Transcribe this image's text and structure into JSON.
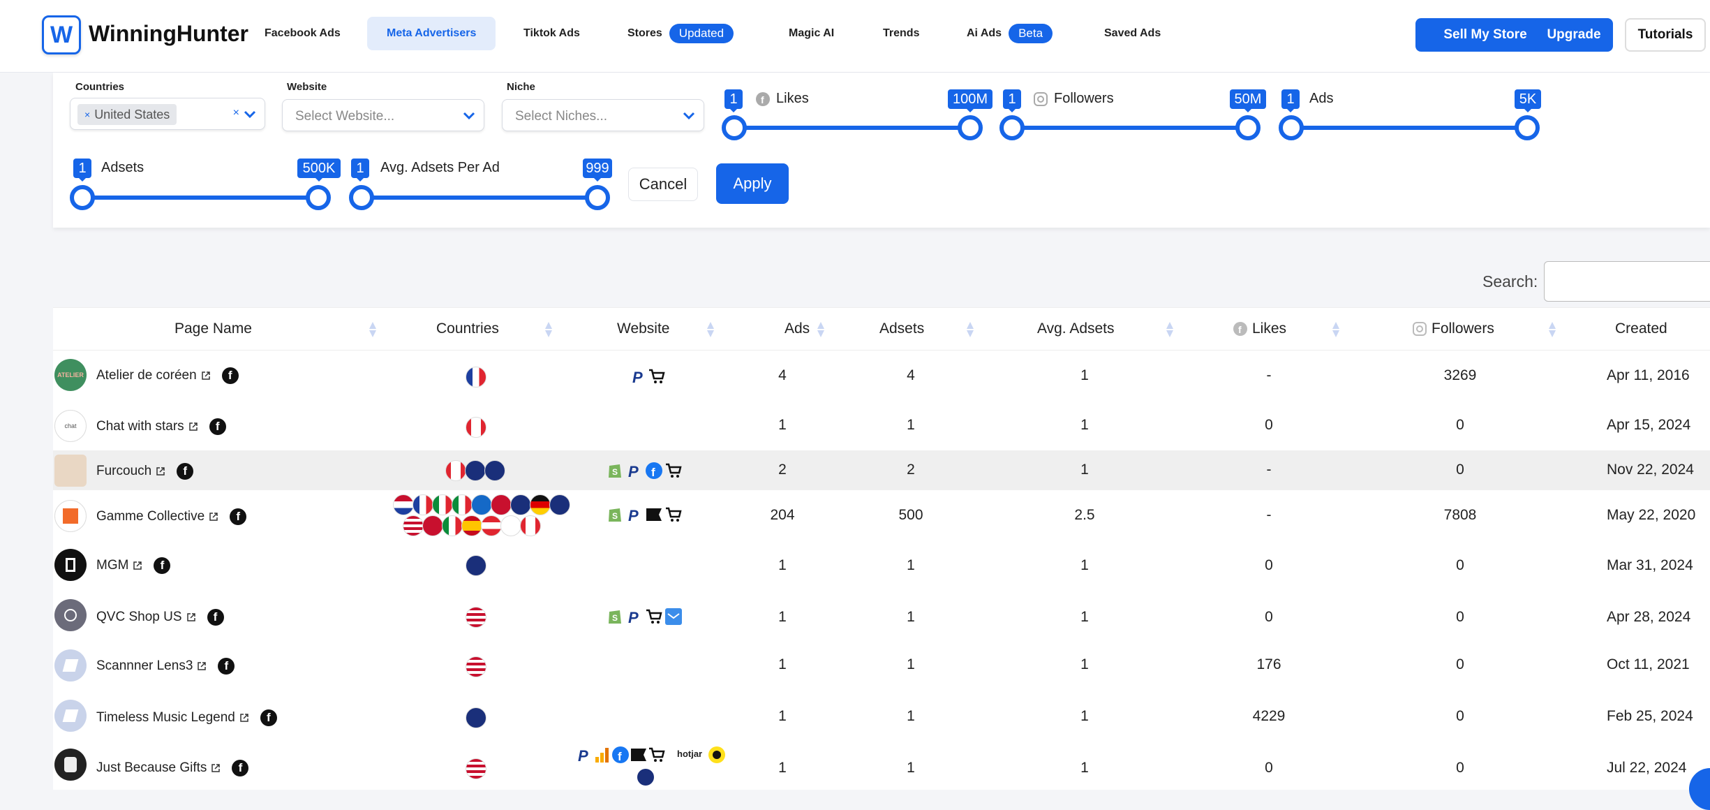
{
  "brand": {
    "name": "WinningHunter",
    "logo_letter": "W"
  },
  "nav": {
    "items": [
      {
        "label": "Facebook Ads"
      },
      {
        "label": "Meta Advertisers"
      },
      {
        "label": "Tiktok Ads"
      },
      {
        "label": "Stores",
        "badge": "Updated"
      },
      {
        "label": "Magic AI"
      },
      {
        "label": "Trends"
      },
      {
        "label": "Ai Ads",
        "badge": "Beta"
      },
      {
        "label": "Saved Ads"
      }
    ],
    "sell_button": "Sell My Store",
    "upgrade_button": "Upgrade",
    "tutorials_button": "Tutorials"
  },
  "filters": {
    "countries": {
      "label": "Countries",
      "selected": "United States"
    },
    "website": {
      "label": "Website",
      "placeholder": "Select Website..."
    },
    "niche": {
      "label": "Niche",
      "placeholder": "Select Niches..."
    },
    "likes": {
      "label": "Likes",
      "min": "1",
      "max": "100M"
    },
    "followers": {
      "label": "Followers",
      "min": "1",
      "max": "50M"
    },
    "ads": {
      "label": "Ads",
      "min": "1",
      "max": "5K"
    },
    "adsets": {
      "label": "Adsets",
      "min": "1",
      "max": "500K"
    },
    "avg_adsets": {
      "label": "Avg. Adsets Per Ad",
      "min": "1",
      "max": "999"
    },
    "cancel": "Cancel",
    "apply": "Apply"
  },
  "search": {
    "label": "Search:"
  },
  "table": {
    "columns": [
      "Page Name",
      "Countries",
      "Website",
      "Ads",
      "Adsets",
      "Avg. Adsets",
      "Likes",
      "Followers",
      "Created"
    ],
    "rows": [
      {
        "name": "Atelier de coréen",
        "ads": "4",
        "adsets": "4",
        "avg": "1",
        "likes": "-",
        "followers": "3269",
        "created": "Apr 11, 2016"
      },
      {
        "name": "Chat with stars",
        "ads": "1",
        "adsets": "1",
        "avg": "1",
        "likes": "0",
        "followers": "0",
        "created": "Apr 15, 2024"
      },
      {
        "name": "Furcouch",
        "ads": "2",
        "adsets": "2",
        "avg": "1",
        "likes": "-",
        "followers": "0",
        "created": "Nov 22, 2024"
      },
      {
        "name": "Gamme Collective",
        "ads": "204",
        "adsets": "500",
        "avg": "2.5",
        "likes": "-",
        "followers": "7808",
        "created": "May 22, 2020"
      },
      {
        "name": "MGM",
        "ads": "1",
        "adsets": "1",
        "avg": "1",
        "likes": "0",
        "followers": "0",
        "created": "Mar 31, 2024"
      },
      {
        "name": "QVC Shop US",
        "ads": "1",
        "adsets": "1",
        "avg": "1",
        "likes": "0",
        "followers": "0",
        "created": "Apr 28, 2024"
      },
      {
        "name": "Scannner Lens3",
        "ads": "1",
        "adsets": "1",
        "avg": "1",
        "likes": "176",
        "followers": "0",
        "created": "Oct 11, 2021"
      },
      {
        "name": "Timeless Music Legend",
        "ads": "1",
        "adsets": "1",
        "avg": "1",
        "likes": "4229",
        "followers": "0",
        "created": "Feb 25, 2024"
      },
      {
        "name": "Just Because Gifts",
        "ads": "1",
        "adsets": "1",
        "avg": "1",
        "likes": "0",
        "followers": "0",
        "created": "Jul 22, 2024"
      }
    ],
    "website_text": {
      "hotjar": "hotjar"
    }
  },
  "colors": {
    "accent": "#1665e8"
  }
}
